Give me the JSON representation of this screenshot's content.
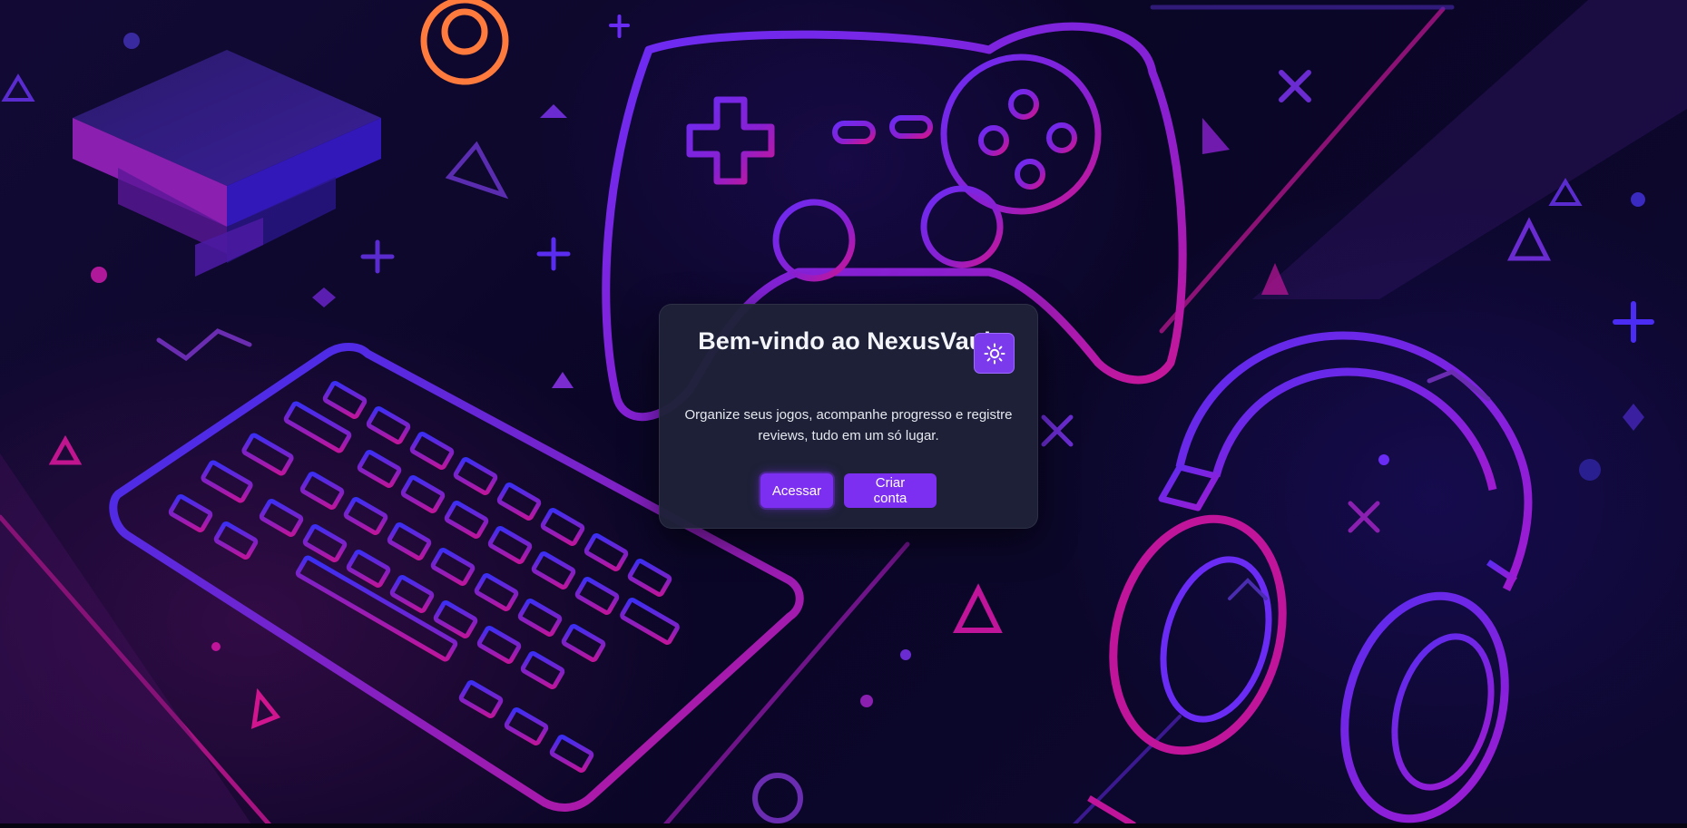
{
  "page": {
    "background_theme": "neon gaming illustration (controller, keyboard, headphones)"
  },
  "welcome_modal": {
    "title": "Bem-vindo ao NexusVault",
    "description": "Organize seus jogos, acompanhe progresso e registre reviews, tudo em um só lugar.",
    "login_label": "Acessar",
    "signup_label": "Criar conta",
    "theme_toggle_icon": "sun-icon"
  },
  "colors": {
    "accent": "#7c2ff0",
    "modal_bg": "#1e2137",
    "neon_purple": "#6a2cf5",
    "neon_magenta": "#c0159a",
    "neon_orange": "#ff7a3d"
  }
}
